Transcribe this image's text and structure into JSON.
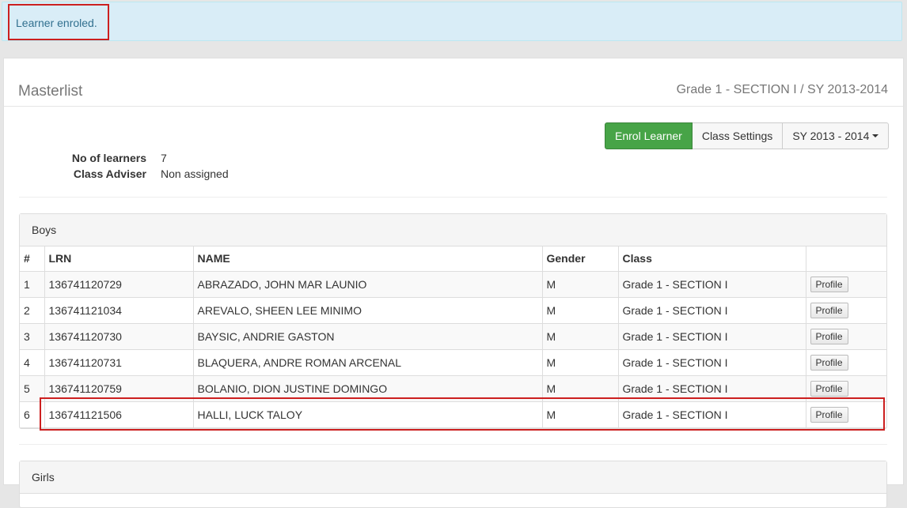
{
  "alert": {
    "message": "Learner enroled."
  },
  "header": {
    "title": "Masterlist",
    "subtitle": "Grade 1 - SECTION I / SY 2013-2014"
  },
  "toolbar": {
    "enrol_label": "Enrol Learner",
    "settings_label": "Class Settings",
    "sy_label": "SY 2013 - 2014"
  },
  "summary": {
    "learners_label": "No of learners",
    "learners_value": "7",
    "adviser_label": "Class Adviser",
    "adviser_value": "Non assigned"
  },
  "boys": {
    "title": "Boys",
    "columns": [
      "#",
      "LRN",
      "NAME",
      "Gender",
      "Class",
      ""
    ],
    "rows": [
      {
        "num": "1",
        "lrn": "136741120729",
        "name": "ABRAZADO, JOHN MAR LAUNIO",
        "gender": "M",
        "class": "Grade 1 - SECTION I",
        "action": "Profile"
      },
      {
        "num": "2",
        "lrn": "136741121034",
        "name": "AREVALO, SHEEN LEE MINIMO",
        "gender": "M",
        "class": "Grade 1 - SECTION I",
        "action": "Profile"
      },
      {
        "num": "3",
        "lrn": "136741120730",
        "name": "BAYSIC, ANDRIE GASTON",
        "gender": "M",
        "class": "Grade 1 - SECTION I",
        "action": "Profile"
      },
      {
        "num": "4",
        "lrn": "136741120731",
        "name": "BLAQUERA, ANDRE ROMAN ARCENAL",
        "gender": "M",
        "class": "Grade 1 - SECTION I",
        "action": "Profile"
      },
      {
        "num": "5",
        "lrn": "136741120759",
        "name": "BOLANIO, DION JUSTINE DOMINGO",
        "gender": "M",
        "class": "Grade 1 - SECTION I",
        "action": "Profile"
      },
      {
        "num": "6",
        "lrn": "136741121506",
        "name": "HALLI, LUCK TALOY",
        "gender": "M",
        "class": "Grade 1 - SECTION I",
        "action": "Profile"
      }
    ]
  },
  "girls": {
    "title": "Girls"
  },
  "colors": {
    "success": "#47a447",
    "alert_bg": "#d9edf7",
    "highlight": "#cc1f1f"
  }
}
